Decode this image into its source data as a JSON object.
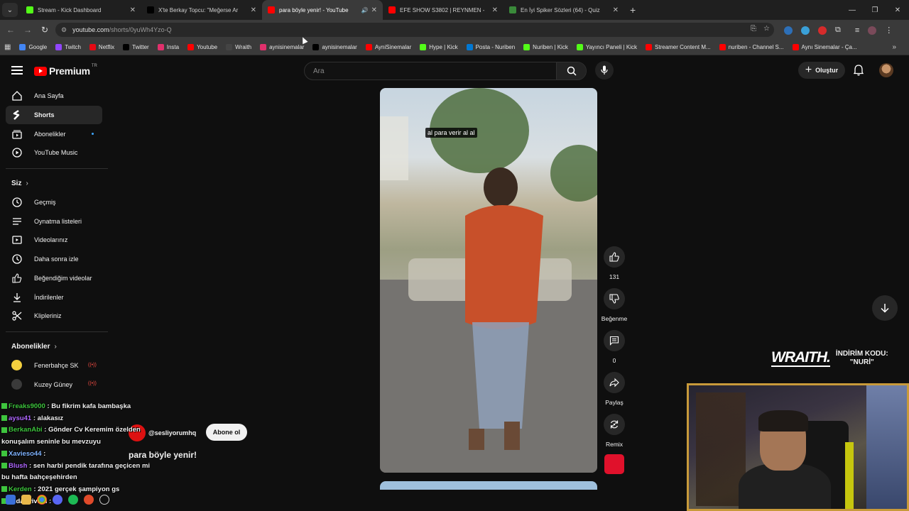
{
  "browser": {
    "tabs": [
      {
        "label": "Stream - Kick Dashboard",
        "color": "#53fc18",
        "active": false
      },
      {
        "label": "X'te Berkay Topcu: \"Meğerse Ar",
        "color": "#000000",
        "active": false
      },
      {
        "label": "para böyle yenir! - YouTube",
        "color": "#ff0000",
        "active": true
      },
      {
        "label": "EFE SHOW S3802 | REYNMEN -",
        "color": "#ff0000",
        "active": false
      },
      {
        "label": "En İyi Spiker Sözleri (64) - Quiz",
        "color": "#3a8a3a",
        "active": false
      }
    ],
    "url_host": "youtube.com",
    "url_path": "/shorts/0yuWh4Yzo-Q",
    "bookmarks": [
      {
        "label": "Google",
        "color": "#4285f4"
      },
      {
        "label": "Twitch",
        "color": "#9146ff"
      },
      {
        "label": "Netflix",
        "color": "#e50914"
      },
      {
        "label": "Twitter",
        "color": "#000000"
      },
      {
        "label": "Insta",
        "color": "#e1306c"
      },
      {
        "label": "Youtube",
        "color": "#ff0000"
      },
      {
        "label": "Wraith",
        "color": "#444444"
      },
      {
        "label": "aynisinemalar",
        "color": "#e1306c"
      },
      {
        "label": "aynisinemalar",
        "color": "#000000"
      },
      {
        "label": "AyniSinemalar",
        "color": "#ff0000"
      },
      {
        "label": "Hype | Kick",
        "color": "#53fc18"
      },
      {
        "label": "Posta - Nuriben",
        "color": "#0078d4"
      },
      {
        "label": "Nuriben | Kick",
        "color": "#53fc18"
      },
      {
        "label": "Yayıncı Paneli | Kick",
        "color": "#53fc18"
      },
      {
        "label": "Streamer Content M...",
        "color": "#ff0000"
      },
      {
        "label": "nuriben - Channel S...",
        "color": "#ff0000"
      },
      {
        "label": "Aynı Sinemalar - Ça...",
        "color": "#ff0000"
      }
    ]
  },
  "youtube": {
    "logo": "Premium",
    "region": "TR",
    "search_placeholder": "Ara",
    "create_label": "Oluştur",
    "sidebar": {
      "main": [
        {
          "label": "Ana Sayfa",
          "icon": "home-icon"
        },
        {
          "label": "Shorts",
          "icon": "shorts-icon"
        },
        {
          "label": "Abonelikler",
          "icon": "subscriptions-icon"
        },
        {
          "label": "YouTube Music",
          "icon": "music-icon"
        }
      ],
      "you_heading": "Siz",
      "you": [
        {
          "label": "Geçmiş",
          "icon": "history-icon"
        },
        {
          "label": "Oynatma listeleri",
          "icon": "playlists-icon"
        },
        {
          "label": "Videolarınız",
          "icon": "your-videos-icon"
        },
        {
          "label": "Daha sonra izle",
          "icon": "watch-later-icon"
        },
        {
          "label": "Beğendiğim videolar",
          "icon": "liked-icon"
        },
        {
          "label": "İndirilenler",
          "icon": "downloads-icon"
        },
        {
          "label": "Klipleriniz",
          "icon": "clips-icon"
        }
      ],
      "subs_heading": "Abonelikler",
      "subs": [
        {
          "label": "Fenerbahçe SK",
          "color": "#f4d03f"
        },
        {
          "label": "Kuzey Güney",
          "color": "#3a3a3a"
        }
      ]
    },
    "short": {
      "caption": "al para verir al al",
      "channel": "@sesliyorumhq",
      "subscribe": "Abone ol",
      "title": "para böyle yenir!",
      "likes": "131",
      "dislike_label": "Beğenme",
      "comments": "0",
      "share_label": "Paylaş",
      "remix_label": "Remix"
    }
  },
  "overlay": {
    "chat": [
      {
        "user": "Freaks9000",
        "color": "#3ec53e",
        "msg": ": Bu fikrim kafa bambaşka"
      },
      {
        "user": "aysu41",
        "color": "#b067ff",
        "msg": ": alakasız"
      },
      {
        "user": "BerkanAbi",
        "color": "#3ec53e",
        "msg": ": Gönder Cv Keremim özelden"
      },
      {
        "user": "",
        "color": "#ffffff",
        "msg": "konuşalım seninle bu mevzuyu"
      },
      {
        "user": "Xavieso44",
        "color": "#7fb3ff",
        "msg": ": "
      },
      {
        "user": "Blush",
        "color": "#b067ff",
        "msg": ": sen harbi pendik tarafına geçicen mi"
      },
      {
        "user": "",
        "color": "#ffffff",
        "msg": "bu hafta bahçeşehirden"
      },
      {
        "user": "Kerden",
        "color": "#3ec53e",
        "msg": ": 2021 gerçek şampiyon gs"
      },
      {
        "user": "vildanvivian",
        "color": "#ffffff",
        "msg": ":"
      }
    ],
    "sponsor_brand": "WRAITH.",
    "sponsor_code_line1": "İNDİRİM KODU:",
    "sponsor_code_line2": "\"NURİ\""
  }
}
